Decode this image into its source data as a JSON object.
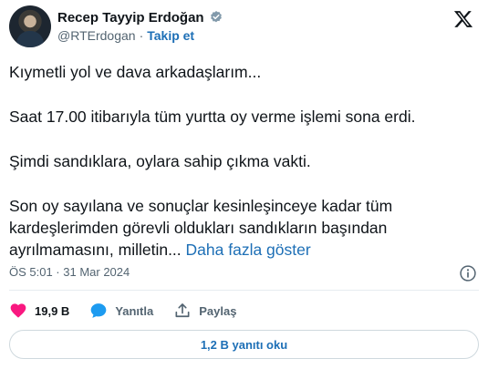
{
  "author": {
    "name": "Recep Tayyip Erdoğan",
    "handle": "@RTErdogan",
    "separator": "·",
    "follow_label": "Takip et"
  },
  "icons": {
    "verified": "verified-badge-icon",
    "platform_logo": "x-logo-icon",
    "info": "info-icon",
    "like": "heart-icon",
    "reply": "speech-bubble-icon",
    "share": "share-upload-icon"
  },
  "colors": {
    "accent": "#1d6fb6",
    "like": "#f91880",
    "text": "#0f1419",
    "muted": "#536471"
  },
  "tweet": {
    "paragraphs": [
      "Kıymetli yol ve dava arkadaşlarım...",
      "Saat 17.00 itibarıyla tüm yurtta oy verme işlemi sona erdi.",
      "Şimdi sandıklara, oylara sahip çıkma vakti.",
      "Son oy sayılana ve sonuçlar kesinleşinceye kadar tüm kardeşlerimden görevli oldukları sandıkların başından ayrılmamasını, milletin..."
    ],
    "show_more": "Daha fazla göster",
    "timestamp": "ÖS 5:01 · 31 Mar 2024"
  },
  "actions": {
    "like_count": "19,9 B",
    "reply_label": "Yanıtla",
    "share_label": "Paylaş"
  },
  "read_replies_label": "1,2 B yanıtı oku"
}
